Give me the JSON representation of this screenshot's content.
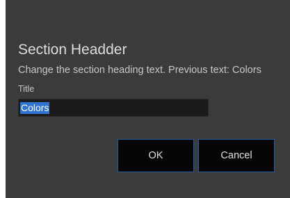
{
  "dialog": {
    "title": "Section Headder",
    "description": "Change the section heading text. Previous text: Colors",
    "field_label": "Title",
    "field_value": "Colors",
    "ok_label": "OK",
    "cancel_label": "Cancel"
  },
  "colors": {
    "background": "#3b3b3b",
    "input_background": "#1b1b1b",
    "selection": "#2f74d0",
    "button_background": "#050505",
    "button_border": "#1f5fa8"
  }
}
